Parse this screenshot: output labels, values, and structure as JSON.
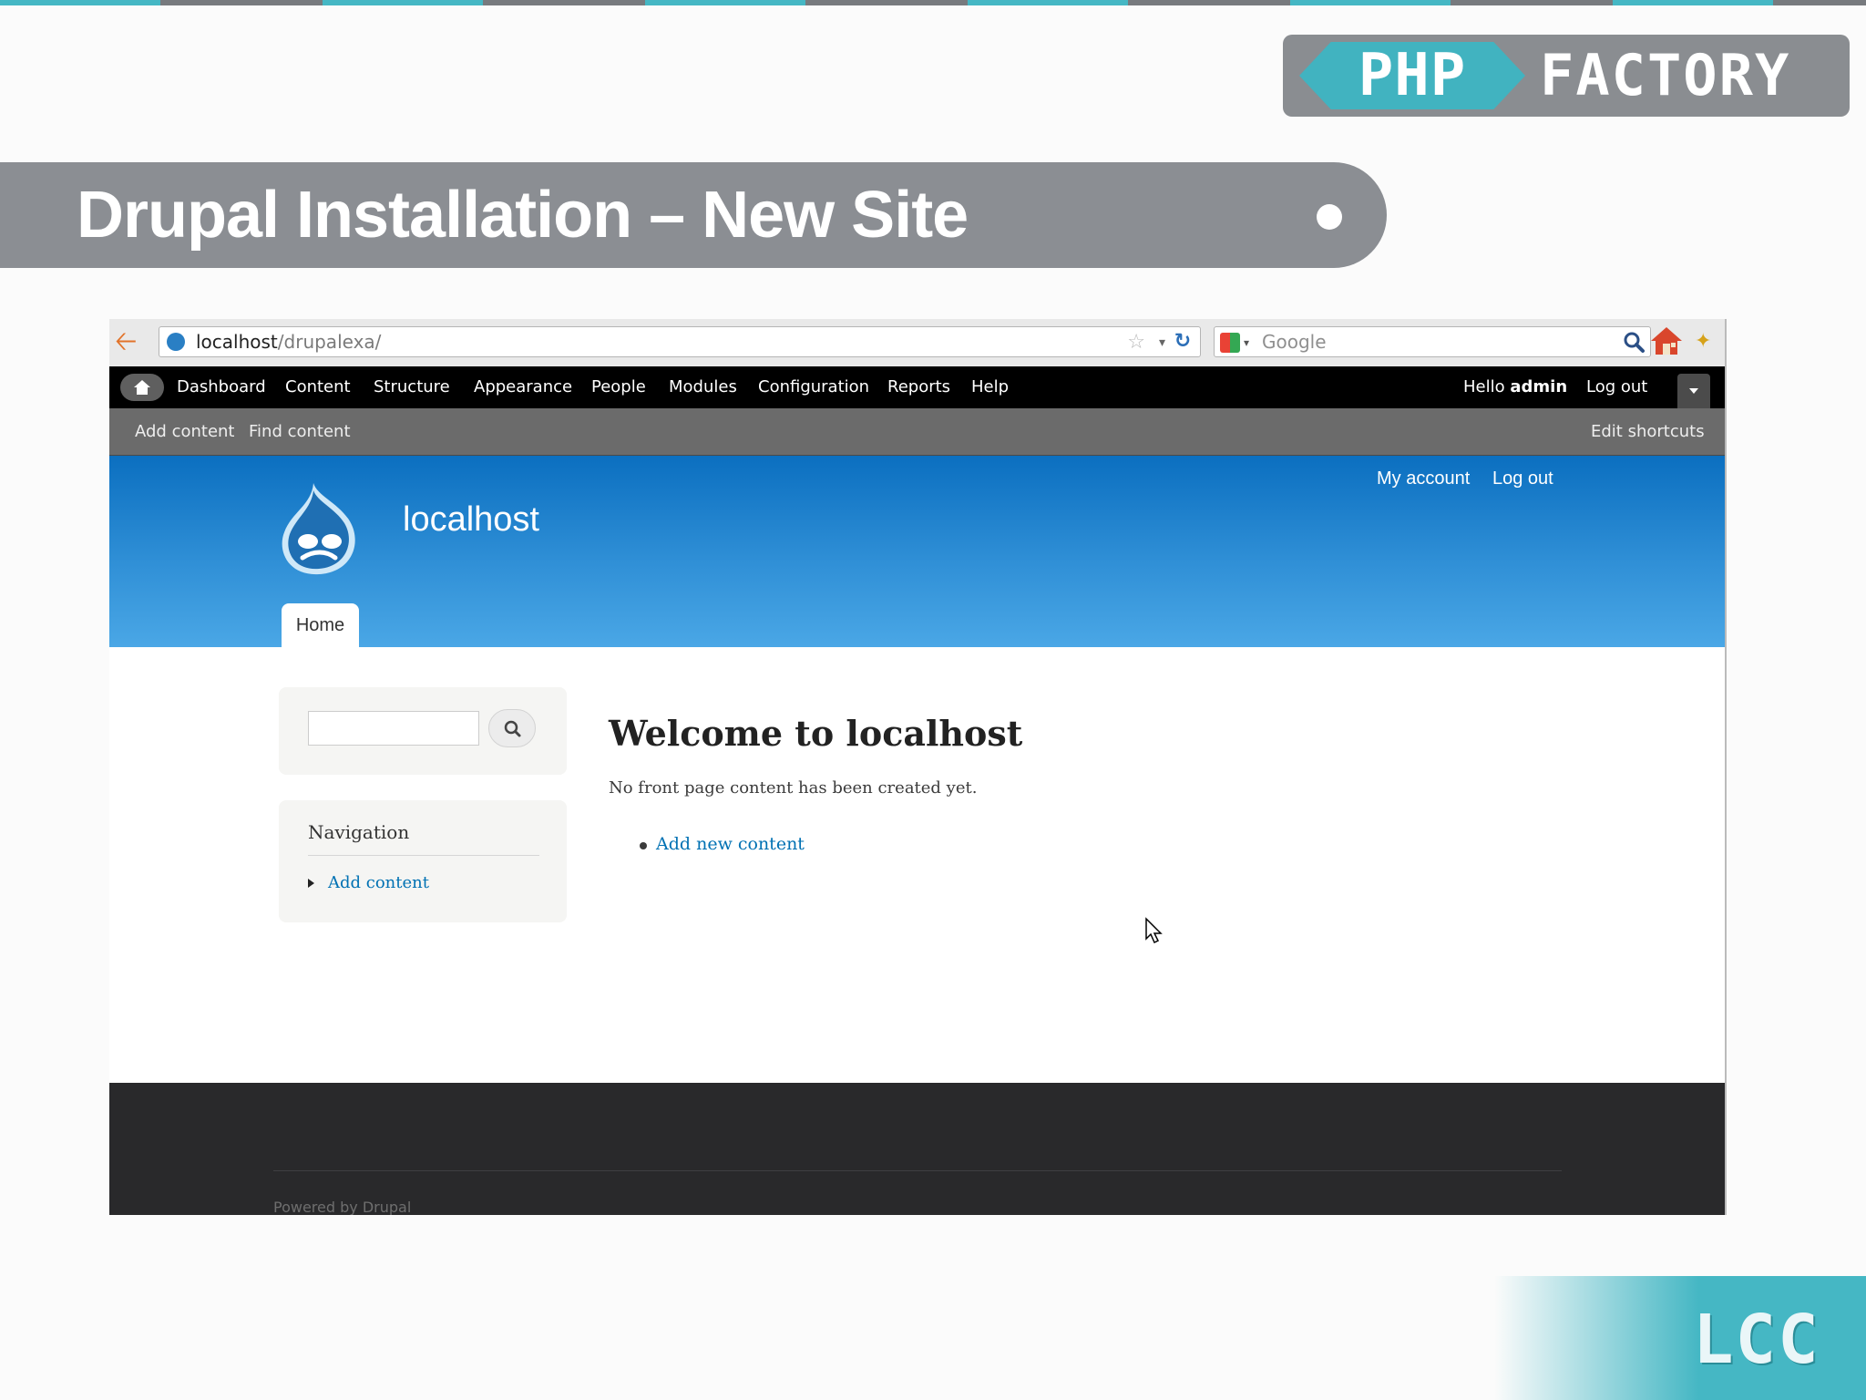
{
  "slide": {
    "title": "Drupal Installation – New Site",
    "logo_left": "PHP",
    "logo_right": "FACTORY",
    "corner_logo": "LCC"
  },
  "browser": {
    "url_host": "localhost",
    "url_path": "/drupalexa/",
    "search_placeholder": "Google",
    "icons": [
      "back-arrow-icon",
      "site-favicon-icon",
      "bookmark-star-icon",
      "reload-icon",
      "search-engine-icon",
      "search-icon",
      "home-icon",
      "addon-icon"
    ]
  },
  "toolbar": {
    "items": [
      "Dashboard",
      "Content",
      "Structure",
      "Appearance",
      "People",
      "Modules",
      "Configuration",
      "Reports",
      "Help"
    ],
    "hello_prefix": "Hello ",
    "user": "admin",
    "logout": "Log out"
  },
  "shortcuts": {
    "add_content": "Add content",
    "find_content": "Find content",
    "edit_shortcuts": "Edit shortcuts"
  },
  "header": {
    "site_name": "localhost",
    "my_account": "My account",
    "log_out": "Log out",
    "tab_home": "Home"
  },
  "sidebar": {
    "nav_title": "Navigation",
    "nav_link": "Add content"
  },
  "content": {
    "heading": "Welcome to localhost",
    "message": "No front page content has been created yet.",
    "add_link": "Add new content"
  },
  "footer": {
    "text": "Powered by Drupal"
  },
  "colors": {
    "accent_teal": "#45b7c4",
    "banner_gray": "#8b8e93",
    "header_blue": "#0b6fc0",
    "link_blue": "#0071b3",
    "footer_dark": "#29292b"
  }
}
